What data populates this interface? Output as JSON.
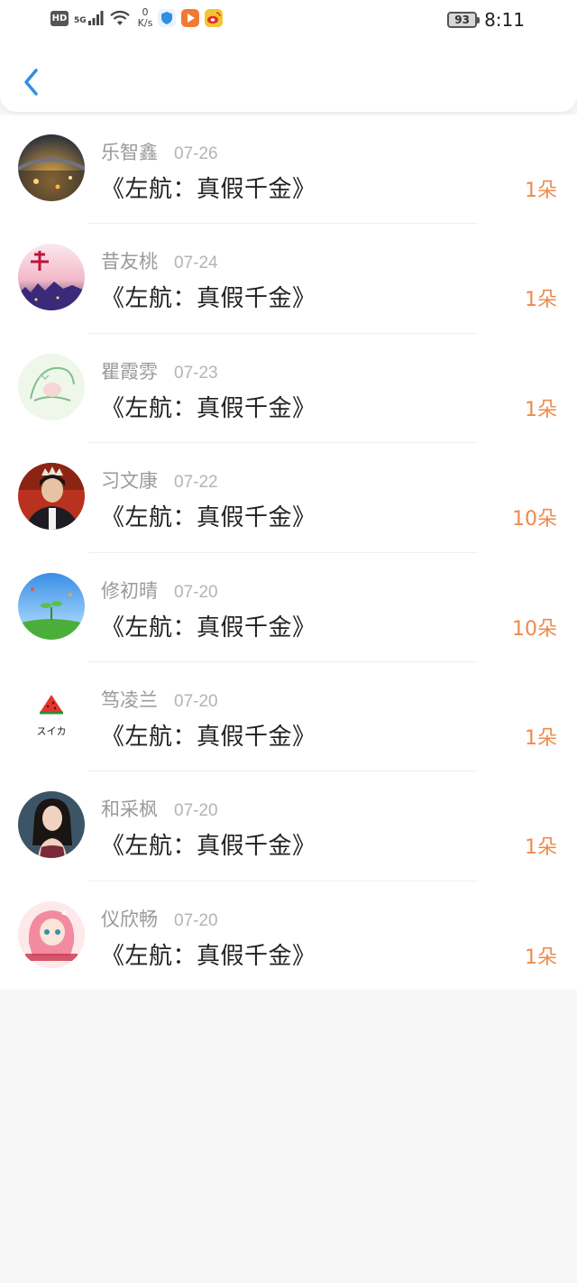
{
  "status_bar": {
    "left_badge": "HD",
    "network": "5G",
    "net_speed_value": "0",
    "net_speed_unit": "K/s",
    "battery": "93",
    "time": "8:11",
    "app_icons": [
      "shield-app-icon",
      "video-app-icon",
      "weibo-icon"
    ]
  },
  "header": {
    "back_icon": "chevron-left-icon"
  },
  "records": [
    {
      "user": "乐智鑫",
      "date": "07-26",
      "book": "《左航：真假千金》",
      "amount": "1朵",
      "avatar": "bridge-night"
    },
    {
      "user": "昔友桃",
      "date": "07-24",
      "book": "《左航：真假千金》",
      "amount": "1朵",
      "avatar": "city-calligraphy"
    },
    {
      "user": "瞿霞雰",
      "date": "07-23",
      "book": "《左航：真假千金》",
      "amount": "1朵",
      "avatar": "sketch-creature"
    },
    {
      "user": "习文康",
      "date": "07-22",
      "book": "《左航：真假千金》",
      "amount": "10朵",
      "avatar": "person-crown"
    },
    {
      "user": "修初晴",
      "date": "07-20",
      "book": "《左航：真假千金》",
      "amount": "10朵",
      "avatar": "sky-sprout"
    },
    {
      "user": "笃凌兰",
      "date": "07-20",
      "book": "《左航：真假千金》",
      "amount": "1朵",
      "avatar": "watermelon",
      "avatar_text": "スイカ"
    },
    {
      "user": "和采枫",
      "date": "07-20",
      "book": "《左航：真假千金》",
      "amount": "1朵",
      "avatar": "woman-portrait"
    },
    {
      "user": "仪欣畅",
      "date": "07-20",
      "book": "《左航：真假千金》",
      "amount": "1朵",
      "avatar": "anime-girl"
    }
  ],
  "colors": {
    "accent_blue": "#2f8fe0",
    "amount_orange": "#ef8a4a",
    "page_bg": "#f7f6f6"
  }
}
